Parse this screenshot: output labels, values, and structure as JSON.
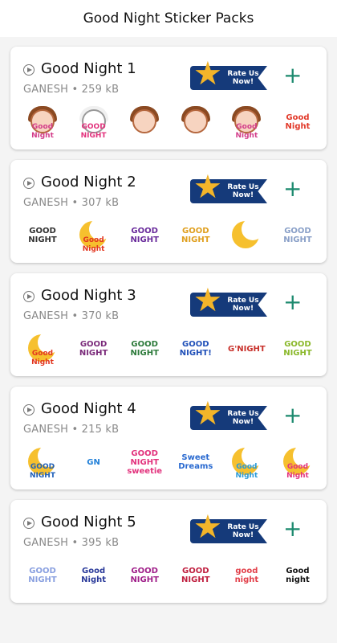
{
  "header": {
    "title": "Good Night Sticker Packs"
  },
  "rate_label": "Rate Us Now!",
  "add_glyph": "+",
  "packs": [
    {
      "title": "Good Night 1",
      "meta": "GANESH • 259 kB",
      "stickers": [
        {
          "type": "girl",
          "text": "Good Night",
          "color": "#d33d8a"
        },
        {
          "type": "cat",
          "text": "GOOD NIGHT",
          "color": "#e2337d"
        },
        {
          "type": "girl",
          "text": "",
          "color": "#d33d8a"
        },
        {
          "type": "girl",
          "text": "",
          "color": "#d33d8a"
        },
        {
          "type": "girl",
          "text": "Good Night",
          "color": "#d33d8a"
        },
        {
          "type": "text",
          "text": "Good Night",
          "color": "#e23a2a"
        }
      ]
    },
    {
      "title": "Good Night 2",
      "meta": "GANESH • 307 kB",
      "stickers": [
        {
          "type": "text",
          "text": "GOOD NIGHT",
          "color": "#333333"
        },
        {
          "type": "moon",
          "text": "Good Night",
          "color": "#e2361f"
        },
        {
          "type": "text",
          "text": "GOOD NIGHT",
          "color": "#6a2c9c"
        },
        {
          "type": "text",
          "text": "GOOD NIGHT",
          "color": "#e0a020"
        },
        {
          "type": "moon",
          "text": "",
          "color": "#e2361f"
        },
        {
          "type": "text",
          "text": "GOOD NIGHT",
          "color": "#8aa0c8"
        }
      ]
    },
    {
      "title": "Good Night 3",
      "meta": "GANESH • 370 kB",
      "stickers": [
        {
          "type": "moon",
          "text": "Good Night",
          "color": "#e2361f"
        },
        {
          "type": "text",
          "text": "GOOD NIGHT",
          "color": "#7a2a7a"
        },
        {
          "type": "text",
          "text": "GOOD NIGHT",
          "color": "#2c7a3a"
        },
        {
          "type": "text",
          "text": "GOOD NIGHT!",
          "color": "#1f4fb8"
        },
        {
          "type": "text",
          "text": "G'NIGHT",
          "color": "#c8302a"
        },
        {
          "type": "text",
          "text": "GOOD NIGHT",
          "color": "#8ab82a"
        }
      ]
    },
    {
      "title": "Good Night 4",
      "meta": "GANESH • 215 kB",
      "stickers": [
        {
          "type": "moon",
          "text": "GOOD NIGHT",
          "color": "#1f5fb8"
        },
        {
          "type": "text",
          "text": "GN",
          "color": "#1f7fd8"
        },
        {
          "type": "text",
          "text": "GOOD NIGHT sweetie",
          "color": "#e2337d"
        },
        {
          "type": "text",
          "text": "Sweet Dreams",
          "color": "#2a6ad0"
        },
        {
          "type": "moon",
          "text": "Good Night",
          "color": "#2a9ad8"
        },
        {
          "type": "moon",
          "text": "Good Night",
          "color": "#e2337d"
        }
      ]
    },
    {
      "title": "Good Night 5",
      "meta": "GANESH • 395 kB",
      "stickers": [
        {
          "type": "text",
          "text": "GOOD NIGHT",
          "color": "#8aa0e0"
        },
        {
          "type": "text",
          "text": "Good Night",
          "color": "#2a3a9a"
        },
        {
          "type": "text",
          "text": "GOOD NIGHT",
          "color": "#a0208a"
        },
        {
          "type": "text",
          "text": "GOOD NIGHT",
          "color": "#c02040"
        },
        {
          "type": "text",
          "text": "good night",
          "color": "#e2404a"
        },
        {
          "type": "text",
          "text": "Good night",
          "color": "#111111"
        }
      ]
    }
  ]
}
